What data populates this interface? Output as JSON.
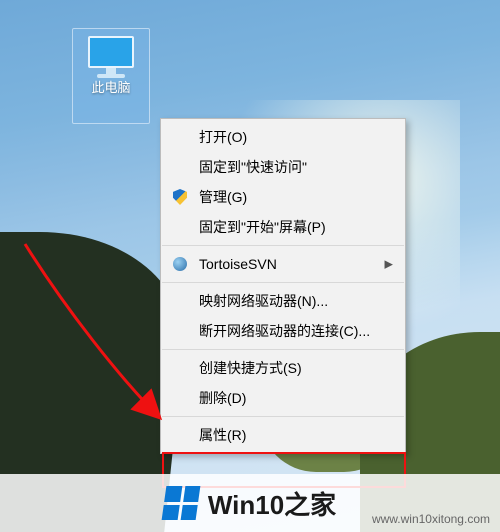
{
  "desktop_icon": {
    "label": "此电脑",
    "icon": "this-pc"
  },
  "context_menu": {
    "items": [
      {
        "label": "打开(O)",
        "icon": null,
        "submenu": false
      },
      {
        "label": "固定到\"快速访问\"",
        "icon": null,
        "submenu": false
      },
      {
        "label": "管理(G)",
        "icon": "shield",
        "submenu": false
      },
      {
        "label": "固定到\"开始\"屏幕(P)",
        "icon": null,
        "submenu": false
      }
    ],
    "items2": [
      {
        "label": "TortoiseSVN",
        "icon": "tortoisesvn",
        "submenu": true
      }
    ],
    "items3": [
      {
        "label": "映射网络驱动器(N)...",
        "icon": null,
        "submenu": false
      },
      {
        "label": "断开网络驱动器的连接(C)...",
        "icon": null,
        "submenu": false
      }
    ],
    "items4": [
      {
        "label": "创建快捷方式(S)",
        "icon": null,
        "submenu": false
      },
      {
        "label": "删除(D)",
        "icon": null,
        "submenu": false
      }
    ],
    "items5": [
      {
        "label": "属性(R)",
        "icon": null,
        "submenu": false
      }
    ]
  },
  "annotation": {
    "highlighted_item": "属性(R)",
    "color": "#ee1111"
  },
  "watermark": {
    "brand": "Win10之家",
    "url": "www.win10xitong.com"
  }
}
